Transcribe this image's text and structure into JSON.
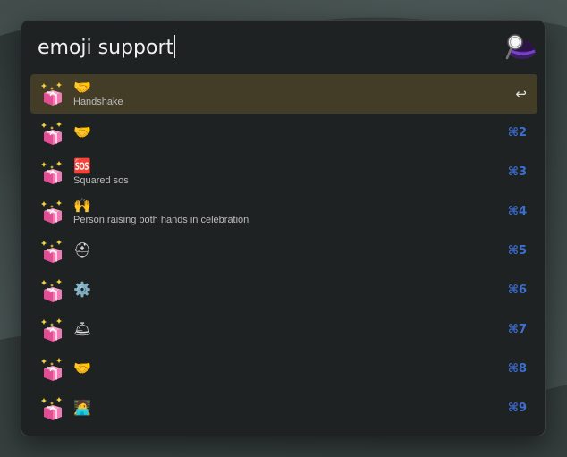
{
  "search": {
    "query": "emoji support"
  },
  "app": {
    "logo_icon": "magnifier-hat-icon"
  },
  "colors": {
    "selected_row": "#433d28",
    "shortcut": "#3d6fd1",
    "panel": "#1f2223"
  },
  "results": [
    {
      "icon": "gift-box-icon",
      "title": "🤝",
      "subtitle": "Handshake",
      "shortcut": "↩"
    },
    {
      "icon": "gift-box-icon",
      "title": "🤝",
      "subtitle": "",
      "shortcut": "⌘2"
    },
    {
      "icon": "gift-box-icon",
      "title": "🆘",
      "subtitle": "Squared sos",
      "shortcut": "⌘3"
    },
    {
      "icon": "gift-box-icon",
      "title": "🙌",
      "subtitle": "Person raising both hands in celebration",
      "shortcut": "⌘4"
    },
    {
      "icon": "gift-box-icon",
      "title": "⛑",
      "subtitle": "",
      "shortcut": "⌘5"
    },
    {
      "icon": "gift-box-icon",
      "title": "⚙️",
      "subtitle": "",
      "shortcut": "⌘6"
    },
    {
      "icon": "gift-box-icon",
      "title": "🛎",
      "subtitle": "",
      "shortcut": "⌘7"
    },
    {
      "icon": "gift-box-icon",
      "title": "🤝",
      "subtitle": "",
      "shortcut": "⌘8"
    },
    {
      "icon": "gift-box-icon",
      "title": "🧑‍💻",
      "subtitle": "",
      "shortcut": "⌘9"
    }
  ]
}
